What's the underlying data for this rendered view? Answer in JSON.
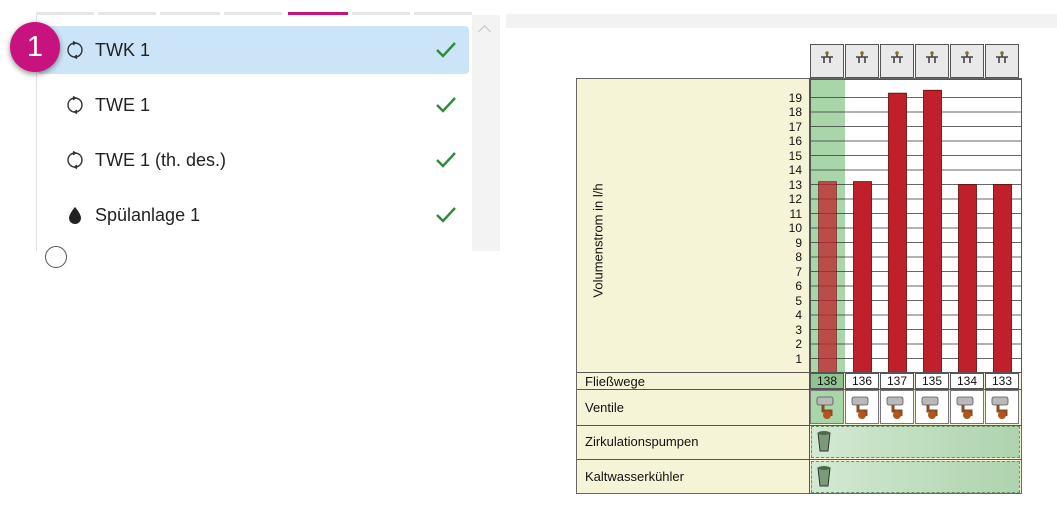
{
  "badge": {
    "number": "1"
  },
  "dropdown": {
    "items": [
      {
        "label": "TWK 1",
        "icon": "cycle-icon",
        "selected": true,
        "checked": true
      },
      {
        "label": "TWE 1",
        "icon": "cycle-icon",
        "selected": false,
        "checked": true
      },
      {
        "label": "TWE 1 (th. des.)",
        "icon": "cycle-icon",
        "selected": false,
        "checked": true
      },
      {
        "label": "Spülanlage 1",
        "icon": "drop-icon",
        "selected": false,
        "checked": true
      }
    ]
  },
  "colors": {
    "badge": "#c8137f",
    "selected_bg": "#cce4f7",
    "check": "#2e8b3a",
    "bar": "#c0202a",
    "panel": "#f6f4d6",
    "highlight": "#a9d6a9"
  },
  "chart_data": {
    "type": "bar",
    "ylabel": "Volumenstrom in l/h",
    "ylim": [
      0,
      20
    ],
    "yticks": [
      "1",
      "2",
      "3",
      "4",
      "5",
      "6",
      "7",
      "8",
      "9",
      "10",
      "11",
      "12",
      "13",
      "14",
      "15",
      "16",
      "17",
      "18",
      "19"
    ],
    "categories": [
      "138",
      "136",
      "137",
      "135",
      "134",
      "133"
    ],
    "values": [
      13.2,
      13.2,
      19.3,
      19.5,
      13.0,
      13.0
    ],
    "highlighted_index": 0,
    "grid": true
  },
  "rows": {
    "fliesswege": "Fließwege",
    "ventile": "Ventile",
    "zirkulationspumpen": "Zirkulationspumpen",
    "kaltwasserkuehler": "Kaltwasserkühler"
  }
}
